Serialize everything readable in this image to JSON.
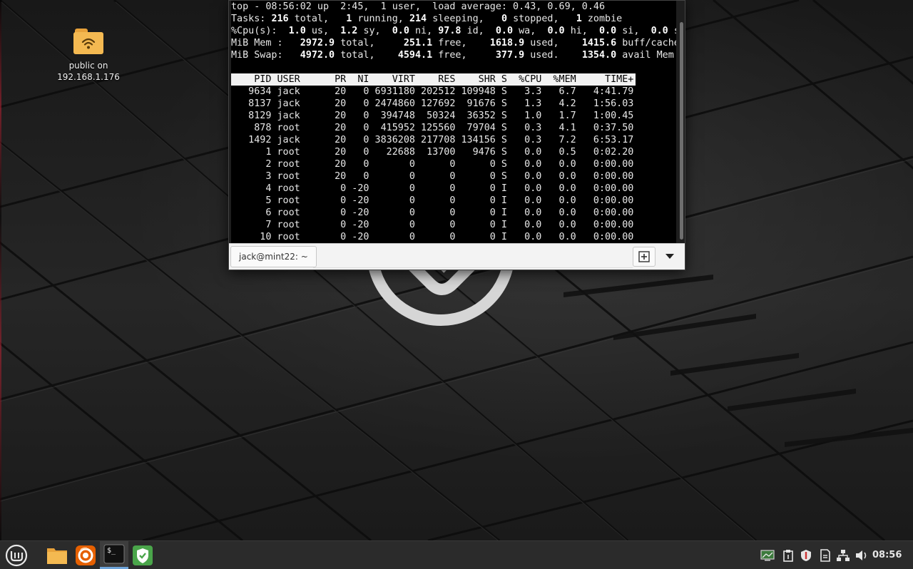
{
  "colors": {
    "terminal_bg": "#000000",
    "header_bg": "#f2f2f2",
    "folder": "#f4b951",
    "mint_green": "#86be43",
    "firefox_orange": "#e66000",
    "active_indicator": "#6ea4d9"
  },
  "desktop": {
    "icon": {
      "label_line1": "public on",
      "label_line2": "192.168.1.176",
      "icon": "network-folder-icon"
    }
  },
  "terminal": {
    "tab_title": "jack@mint22: ~",
    "summary": {
      "line1": "top - 08:56:02 up  2:45,  1 user,  load average: 0.43, 0.69, 0.46",
      "tasks": {
        "label": "Tasks:",
        "total": "216",
        "total_lbl": "total,",
        "running": "1",
        "running_lbl": "running,",
        "sleeping": "214",
        "sleeping_lbl": "sleeping,",
        "stopped": "0",
        "stopped_lbl": "stopped,",
        "zombie": "1",
        "zombie_lbl": "zombie"
      },
      "cpu": {
        "label": "%Cpu(s):",
        "us": "1.0",
        "us_lbl": "us,",
        "sy": "1.2",
        "sy_lbl": "sy,",
        "ni": "0.0",
        "ni_lbl": "ni,",
        "id": "97.8",
        "id_lbl": "id,",
        "wa": "0.0",
        "wa_lbl": "wa,",
        "hi": "0.0",
        "hi_lbl": "hi,",
        "si": "0.0",
        "si_lbl": "si,",
        "st": "0.0",
        "st_lbl": "s"
      },
      "mem": {
        "label": "MiB Mem :",
        "total": "2972.9",
        "total_lbl": "total,",
        "free": "251.1",
        "free_lbl": "free,",
        "used": "1618.9",
        "used_lbl": "used,",
        "buff": "1415.6",
        "buff_lbl": "buff/cache"
      },
      "swap": {
        "label": "MiB Swap:",
        "total": "4972.0",
        "total_lbl": "total,",
        "free": "4594.1",
        "free_lbl": "free,",
        "used": "377.9",
        "used_lbl": "used.",
        "avail": "1354.0",
        "avail_lbl": "avail Mem"
      }
    },
    "header": "    PID USER      PR  NI    VIRT    RES    SHR S  %CPU  %MEM     TIME+",
    "processes": [
      "   9634 jack      20   0 6931180 202512 109948 S   3.3   6.7   4:41.79",
      "   8137 jack      20   0 2474860 127692  91676 S   1.3   4.2   1:56.03",
      "   8129 jack      20   0  394748  50324  36352 S   1.0   1.7   1:00.45",
      "    878 root      20   0  415952 125560  79704 S   0.3   4.1   0:37.50",
      "   1492 jack      20   0 3836208 217708 134156 S   0.3   7.2   6:53.17",
      "      1 root      20   0   22688  13700   9476 S   0.0   0.5   0:02.20",
      "      2 root      20   0       0      0      0 S   0.0   0.0   0:00.00",
      "      3 root      20   0       0      0      0 S   0.0   0.0   0:00.00",
      "      4 root       0 -20       0      0      0 I   0.0   0.0   0:00.00",
      "      5 root       0 -20       0      0      0 I   0.0   0.0   0:00.00",
      "      6 root       0 -20       0      0      0 I   0.0   0.0   0:00.00",
      "      7 root       0 -20       0      0      0 I   0.0   0.0   0:00.00",
      "     10 root       0 -20       0      0      0 I   0.0   0.0   0:00.00"
    ]
  },
  "taskbar": {
    "launchers": [
      {
        "name": "mint-menu",
        "icon": "mint-logo-icon"
      },
      {
        "name": "files",
        "icon": "folder-icon"
      },
      {
        "name": "firefox",
        "icon": "firefox-icon"
      },
      {
        "name": "terminal",
        "icon": "terminal-icon",
        "active": true
      },
      {
        "name": "update-manager",
        "icon": "shield-check-icon"
      }
    ],
    "tray": [
      "display-icon",
      "clipboard-icon",
      "shield-icon",
      "notes-icon",
      "network-icon",
      "volume-icon"
    ],
    "clock": "08:56"
  }
}
